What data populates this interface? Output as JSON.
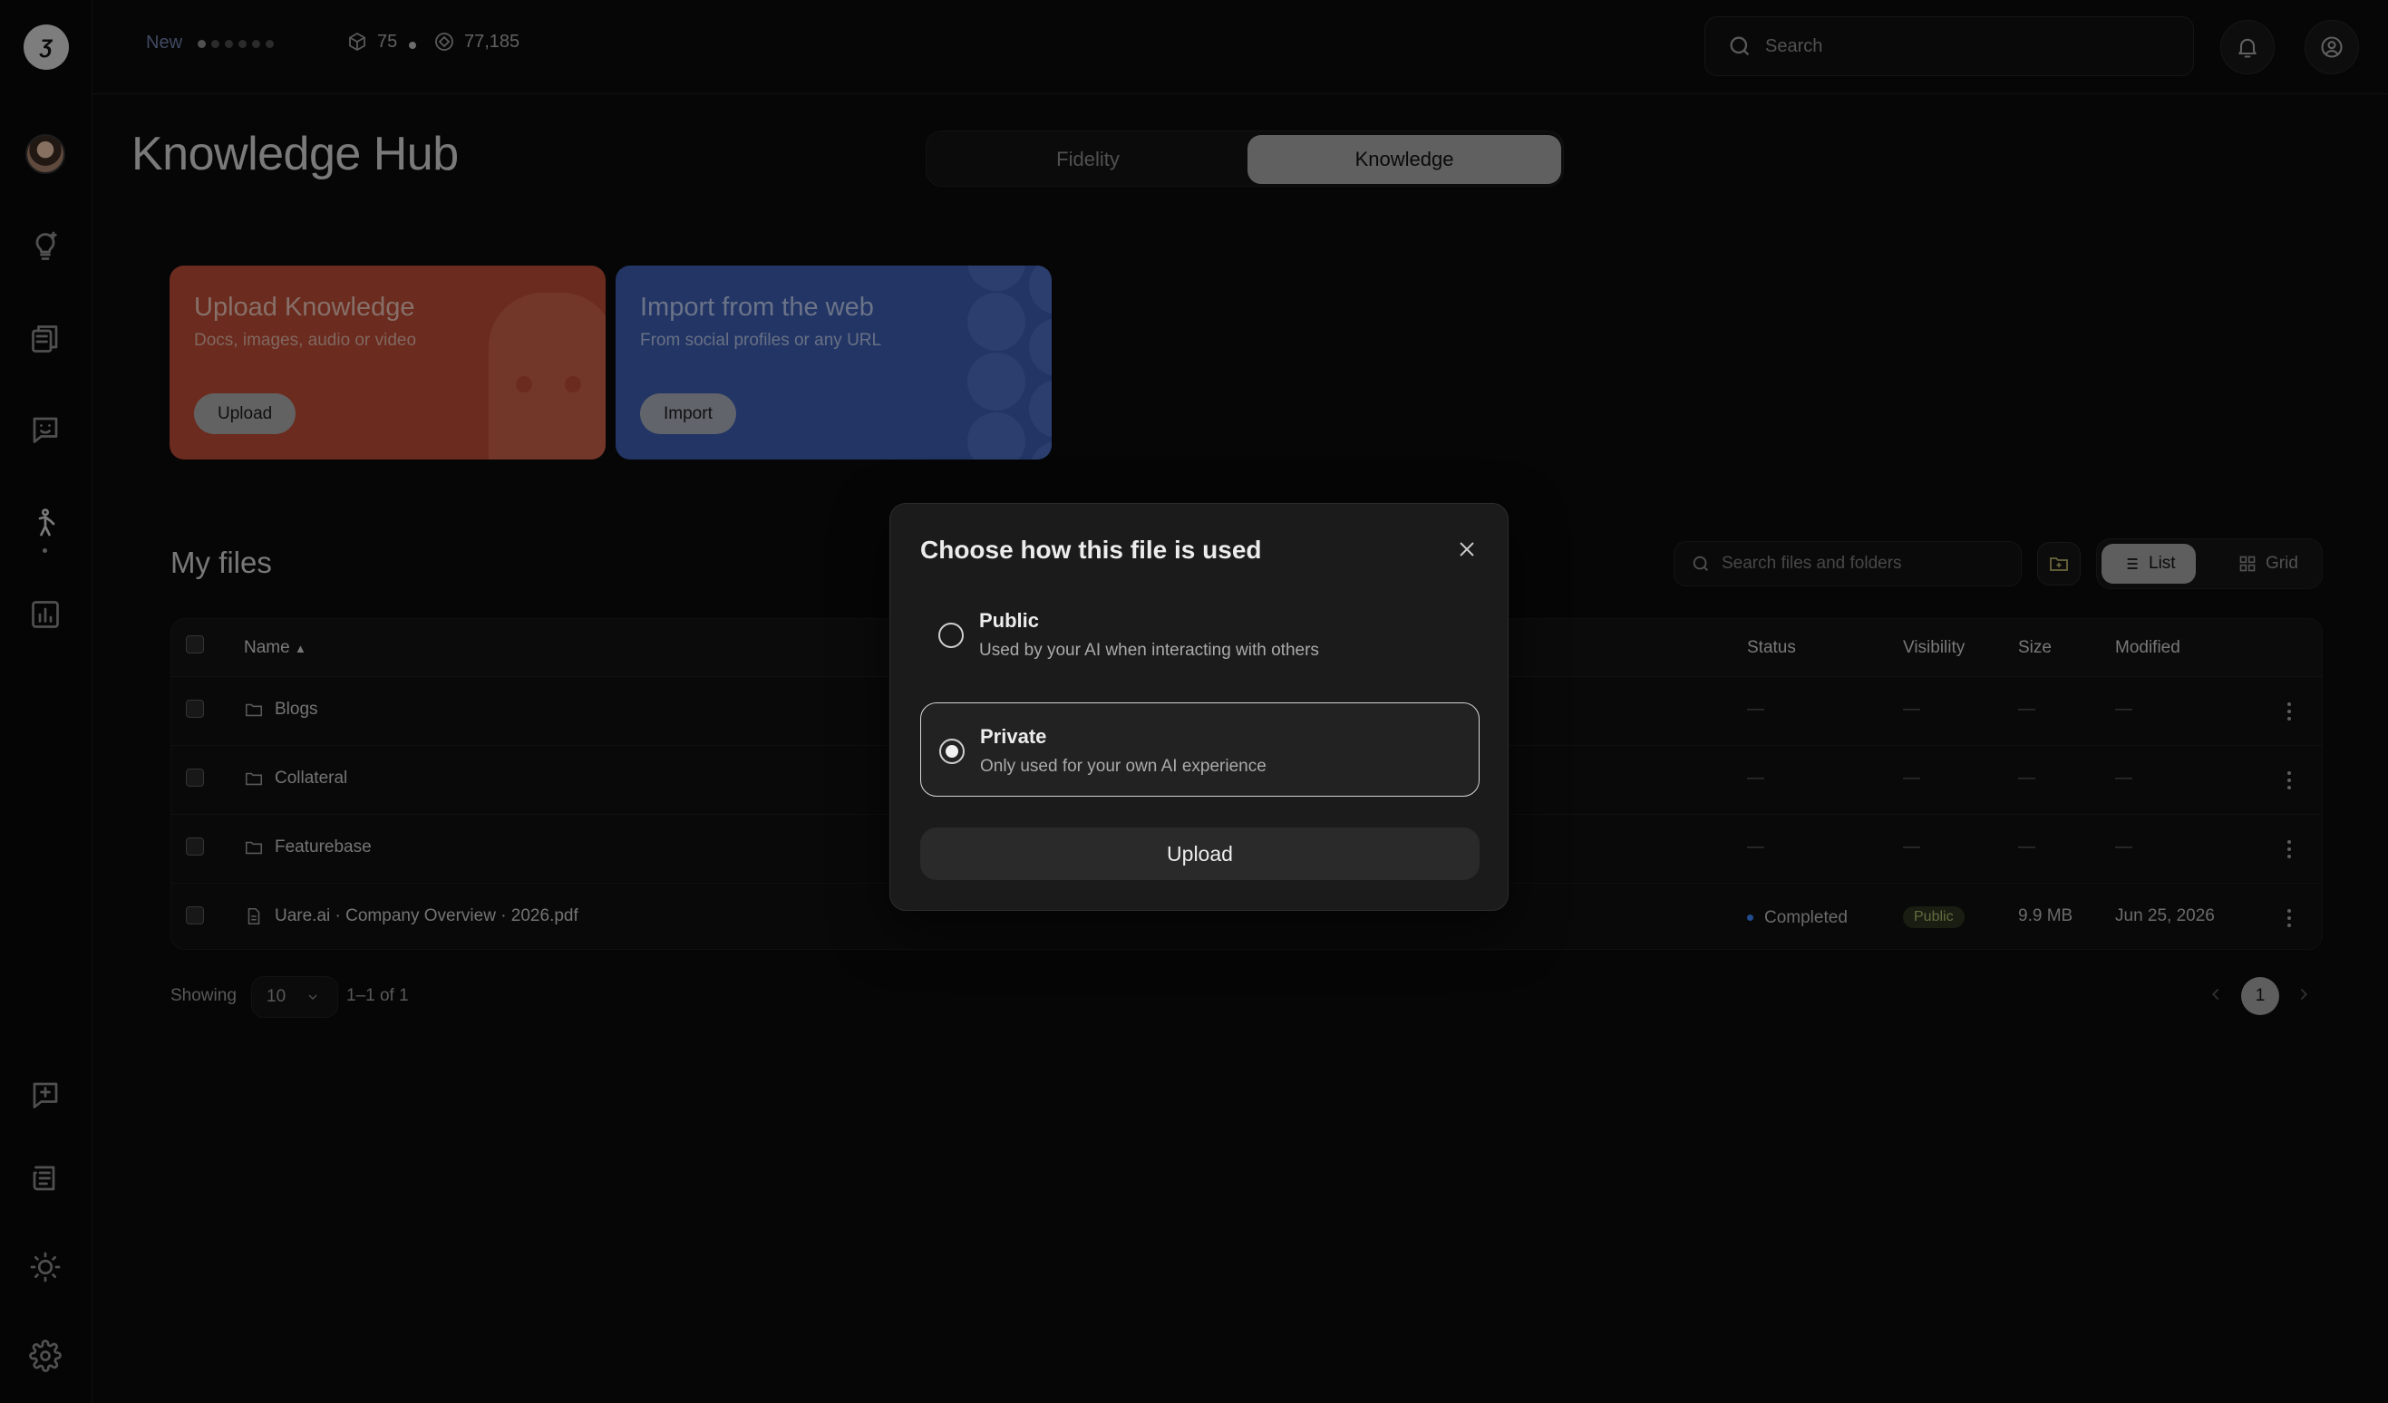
{
  "sidebar": {
    "logo_text": "Ʒ"
  },
  "topbar": {
    "new_label": "New",
    "stat_a": "75",
    "stat_b": "77,185",
    "search_placeholder": "Search"
  },
  "page": {
    "title": "Knowledge Hub",
    "tabs": [
      {
        "label": "Fidelity"
      },
      {
        "label": "Knowledge",
        "active": true
      }
    ]
  },
  "cards": {
    "upload": {
      "title": "Upload Knowledge",
      "subtitle": "Docs, images, audio or video",
      "button": "Upload"
    },
    "import": {
      "title": "Import from the web",
      "subtitle": "From social profiles or any URL",
      "button": "Import"
    }
  },
  "files": {
    "title": "My files",
    "search_placeholder": "Search files and folders",
    "view": {
      "list": "List",
      "grid": "Grid"
    },
    "columns": {
      "name": "Name",
      "status": "Status",
      "visibility": "Visibility",
      "size": "Size",
      "modified": "Modified"
    },
    "dash": "—",
    "rows": [
      {
        "name": "Blogs",
        "type": "folder"
      },
      {
        "name": "Collateral",
        "type": "folder"
      },
      {
        "name": "Featurebase",
        "type": "folder"
      },
      {
        "name": "Uare.ai · Company Overview · 2026.pdf",
        "type": "file",
        "status": "Completed",
        "visibility": "Public",
        "size": "9.9 MB",
        "modified": "Jun 25, 2026"
      }
    ],
    "pagination": {
      "showing_label": "Showing",
      "page_size": "10",
      "range": "1–1 of 1",
      "current_page": "1"
    }
  },
  "modal": {
    "title": "Choose how this file is used",
    "options": [
      {
        "title": "Public",
        "description": "Used by your AI when interacting with others",
        "selected": false
      },
      {
        "title": "Private",
        "description": "Only used for your own AI experience",
        "selected": true
      }
    ],
    "upload_button": "Upload"
  },
  "colors": {
    "upload_card": "#b84b34",
    "import_card": "#3b5caf",
    "status_completed": "#3b84f5",
    "public_badge": "#a9b96b"
  },
  "icons": [
    "search-icon",
    "bell-icon",
    "user-circle-icon",
    "lightbulb-icon",
    "books-icon",
    "chat-face-icon",
    "figure-icon",
    "chart-icon",
    "chat-plus-icon",
    "newspaper-icon",
    "sun-icon",
    "gear-icon",
    "folder-icon",
    "file-icon",
    "close-icon",
    "list-icon",
    "grid-icon"
  ]
}
